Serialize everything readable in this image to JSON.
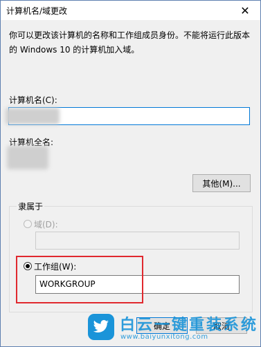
{
  "dialog": {
    "title": "计算机名/域更改",
    "close_glyph": "✕",
    "description": "你可以更改该计算机的名称和工作组成员身份。不能将运行此版本的 Windows 10 的计算机加入域。"
  },
  "computer_name": {
    "label": "计算机名(C):",
    "value": ""
  },
  "full_name": {
    "label": "计算机全名:",
    "value": ""
  },
  "more_button": "其他(M)...",
  "member_of": {
    "label": "隶属于",
    "domain": {
      "label": "域(D):",
      "value": "",
      "selected": false,
      "enabled": false
    },
    "workgroup": {
      "label": "工作组(W):",
      "value": "WORKGROUP",
      "selected": true,
      "enabled": true
    }
  },
  "buttons": {
    "ok": "确定",
    "cancel": "取消"
  },
  "watermark": {
    "title": "白云一键重装系统",
    "url": "www.baiyunxitong.com",
    "icon": "twitter-bird-icon",
    "color": "#1a94d9"
  },
  "colors": {
    "highlight_box": "#e0282e",
    "focus_border": "#0078d7",
    "dialog_bg": "#f0f0f0"
  }
}
